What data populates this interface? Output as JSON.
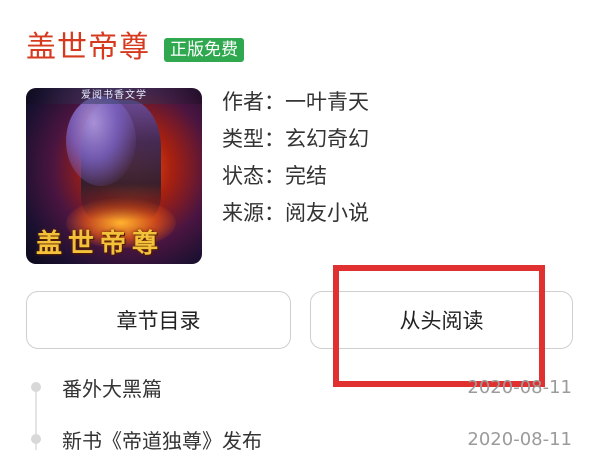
{
  "book": {
    "title": "盖世帝尊",
    "badge": "正版免费",
    "cover_top_text": "爱阅书香文学",
    "cover_title_text": "盖世帝尊"
  },
  "meta": [
    {
      "label": "作者：",
      "value": "一叶青天"
    },
    {
      "label": "类型：",
      "value": "玄幻奇幻"
    },
    {
      "label": "状态：",
      "value": "完结"
    },
    {
      "label": "来源：",
      "value": "阅友小说"
    }
  ],
  "actions": {
    "toc_label": "章节目录",
    "start_label": "从头阅读"
  },
  "chapters": [
    {
      "title": "番外大黑篇",
      "date": "2020-08-11"
    },
    {
      "title": "新书《帝道独尊》发布",
      "date": "2020-08-11"
    }
  ],
  "colors": {
    "title": "#d53a1e",
    "badge_bg": "#2fa84f",
    "highlight": "#e03030"
  }
}
